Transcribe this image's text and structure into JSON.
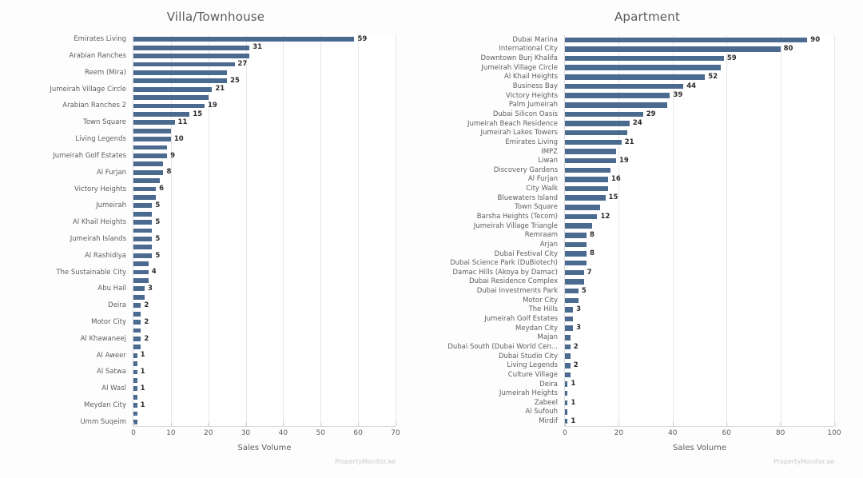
{
  "colors": {
    "bar": "#4a6a90",
    "grid": "#e6e6e6",
    "axis": "#d9d9d9",
    "title_text": "#5a5a5a",
    "label_text": "#5e5e5e",
    "value_text": "#2b2b2b",
    "watermark": "#c9c9c9",
    "background": "#fdfdfd",
    "plot_background": "#ffffff"
  },
  "watermark": "PropertyMonitor.ae",
  "panels": [
    {
      "id": "villa-townhouse",
      "title": "Villa/Townhouse",
      "xlabel": "Sales Volume",
      "watermark": "PropertyMonitor.ae",
      "chart_data": {
        "type": "bar",
        "orientation": "horizontal",
        "title": "Villa/Townhouse",
        "xlabel": "Sales Volume",
        "ylabel": "",
        "xlim": [
          0,
          70
        ],
        "xticks": [
          0,
          10,
          20,
          30,
          40,
          50,
          60,
          70
        ],
        "grid": true,
        "legend": "none",
        "label_every_nth": 2,
        "categories": [
          "Emirates Living",
          "",
          "Arabian Ranches",
          "",
          "Reem (Mira)",
          "",
          "Jumeirah Village Circle",
          "",
          "Arabian Ranches 2",
          "",
          "Town Square",
          "",
          "Living Legends",
          "",
          "Jumeirah Golf Estates",
          "",
          "Al Furjan",
          "",
          "Victory Heights",
          "",
          "Jumeirah",
          "",
          "Al Khail Heights",
          "",
          "Jumeirah Islands",
          "",
          "Al Rashidiya",
          "",
          "The Sustainable City",
          "",
          "Abu Hail",
          "",
          "Deira",
          "",
          "Motor City",
          "",
          "Al Khawaneej",
          "",
          "Al Aweer",
          "",
          "Al Satwa",
          "",
          "Al Wasl",
          "",
          "Meydan City",
          "",
          "Umm Suqeim"
        ],
        "values": [
          59,
          31,
          31,
          27,
          25,
          25,
          21,
          20,
          19,
          15,
          11,
          10,
          10,
          9,
          9,
          8,
          8,
          7,
          6,
          6,
          5,
          5,
          5,
          5,
          5,
          5,
          5,
          4,
          4,
          4,
          3,
          3,
          2,
          2,
          2,
          2,
          2,
          2,
          1,
          1,
          1,
          1,
          1,
          1,
          1,
          1,
          1
        ],
        "value_labels": [
          "59",
          "31",
          "",
          "27",
          "",
          "25",
          "21",
          "",
          "19",
          "15",
          "11",
          "",
          "10",
          "",
          "9",
          "",
          "8",
          "",
          "6",
          "",
          "5",
          "",
          "5",
          "",
          "5",
          "",
          "5",
          "",
          "4",
          "",
          "3",
          "",
          "2",
          "",
          "2",
          "",
          "2",
          "",
          "1",
          "",
          "1",
          "",
          "1",
          "",
          "1",
          "",
          ""
        ]
      }
    },
    {
      "id": "apartment",
      "title": "Apartment",
      "xlabel": "Sales Volume",
      "watermark": "PropertyMonitor.ae",
      "chart_data": {
        "type": "bar",
        "orientation": "horizontal",
        "title": "Apartment",
        "xlabel": "Sales Volume",
        "ylabel": "",
        "xlim": [
          0,
          100
        ],
        "xticks": [
          0,
          20,
          40,
          60,
          80,
          100
        ],
        "grid": true,
        "legend": "none",
        "label_every_nth": 1,
        "categories": [
          "Dubai Marina",
          "International City",
          "Downtown Burj Khalifa",
          "Jumeirah Village Circle",
          "Al Khail Heights",
          "Business Bay",
          "Victory Heights",
          "Palm Jumeirah",
          "Dubai Silicon Oasis",
          "Jumeirah Beach Residence",
          "Jumeirah Lakes Towers",
          "Emirates Living",
          "IMPZ",
          "Liwan",
          "Discovery Gardens",
          "Al Furjan",
          "City Walk",
          "Bluewaters Island",
          "Town Square",
          "Barsha Heights (Tecom)",
          "Jumeirah Village Triangle",
          "Remraam",
          "Arjan",
          "Dubai Festival City",
          "Dubai Science Park (DuBiotech)",
          "Damac Hills (Akoya by Damac)",
          "Dubai Residence Complex",
          "Dubai Investments Park",
          "Motor City",
          "The Hills",
          "Jumeirah Golf Estates",
          "Meydan City",
          "Majan",
          "Dubai South (Dubai World Cen...",
          "Dubai Studio City",
          "Living Legends",
          "Culture Village",
          "Deira",
          "Jumeirah Heights",
          "Zabeel",
          "Al Sufouh",
          "Mirdif"
        ],
        "values": [
          90,
          80,
          59,
          58,
          52,
          44,
          39,
          38,
          29,
          24,
          23,
          21,
          19,
          19,
          17,
          16,
          16,
          15,
          13,
          12,
          10,
          8,
          8,
          8,
          8,
          7,
          7,
          5,
          5,
          3,
          3,
          3,
          2,
          2,
          2,
          2,
          2,
          1,
          1,
          1,
          1,
          1
        ],
        "value_labels": [
          "90",
          "80",
          "59",
          "",
          "52",
          "44",
          "39",
          "",
          "29",
          "24",
          "",
          "21",
          "",
          "19",
          "",
          "16",
          "",
          "15",
          "",
          "12",
          "",
          "8",
          "",
          "8",
          "",
          "7",
          "",
          "5",
          "",
          "3",
          "",
          "3",
          "",
          "2",
          "",
          "2",
          "",
          "1",
          "",
          "1",
          "",
          "1"
        ]
      }
    }
  ]
}
